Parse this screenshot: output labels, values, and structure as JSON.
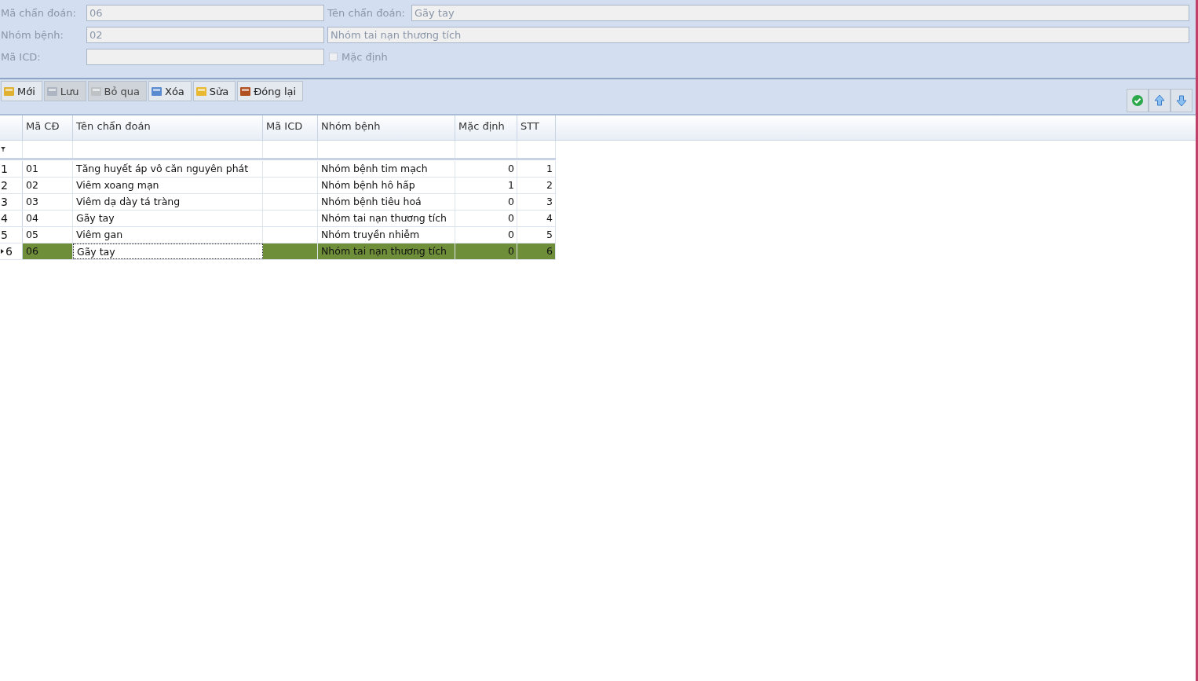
{
  "form": {
    "fields": [
      {
        "label": "Mã chẩn đoán:",
        "value": "06",
        "label2": "Tên chẩn đoán:",
        "value2": "Gãy tay"
      },
      {
        "label": "Nhóm bệnh:",
        "value": "02",
        "value2": "Nhóm tai nạn thương tích"
      },
      {
        "label": "Mã ICD:"
      }
    ],
    "checkbox": {
      "label": "Mặc định",
      "checked": false
    }
  },
  "toolbar": {
    "buttons": [
      {
        "label": "Mới",
        "kind": "new",
        "disabled": false
      },
      {
        "label": "Lưu",
        "kind": "save",
        "disabled": true
      },
      {
        "label": "Bỏ qua",
        "kind": "skip",
        "disabled": true
      },
      {
        "label": "Xóa",
        "kind": "delete",
        "disabled": false
      },
      {
        "label": "Sửa",
        "kind": "edit",
        "disabled": false
      },
      {
        "label": "Đóng lại",
        "kind": "close",
        "disabled": false
      }
    ]
  },
  "table": {
    "columns": [
      {
        "label": "Mã CĐ",
        "kind": "text",
        "focused": false
      },
      {
        "label": "Tên chẩn đoán",
        "kind": "text",
        "focused": true
      },
      {
        "label": "Mã ICD",
        "kind": "text",
        "focused": false
      },
      {
        "label": "Nhóm bệnh",
        "kind": "text",
        "focused": false
      },
      {
        "label": "Mặc định",
        "kind": "number",
        "focused": false
      },
      {
        "label": "STT",
        "kind": "number",
        "focused": false
      }
    ],
    "rows": [
      {
        "index": "1",
        "selected": false,
        "cells": [
          "01",
          "Tăng huyết áp vô căn nguyên phát",
          "",
          "Nhóm bệnh tim mạch",
          "0",
          "1"
        ]
      },
      {
        "index": "2",
        "selected": false,
        "cells": [
          "02",
          "Viêm xoang mạn",
          "",
          "Nhóm bệnh hô hấp",
          "1",
          "2"
        ]
      },
      {
        "index": "3",
        "selected": false,
        "cells": [
          "03",
          "Viêm dạ dày tá tràng",
          "",
          "Nhóm bệnh tiêu hoá",
          "0",
          "3"
        ]
      },
      {
        "index": "4",
        "selected": false,
        "cells": [
          "04",
          "Gãy tay",
          "",
          "Nhóm tai nạn thương tích",
          "0",
          "4"
        ]
      },
      {
        "index": "5",
        "selected": false,
        "cells": [
          "05",
          "Viêm gan",
          "",
          "Nhóm truyền nhiễm",
          "0",
          "5"
        ]
      },
      {
        "index": "6",
        "selected": true,
        "cells": [
          "06",
          "Gãy tay",
          "",
          "Nhóm tai nạn thương tích",
          "0",
          "6"
        ]
      }
    ]
  }
}
